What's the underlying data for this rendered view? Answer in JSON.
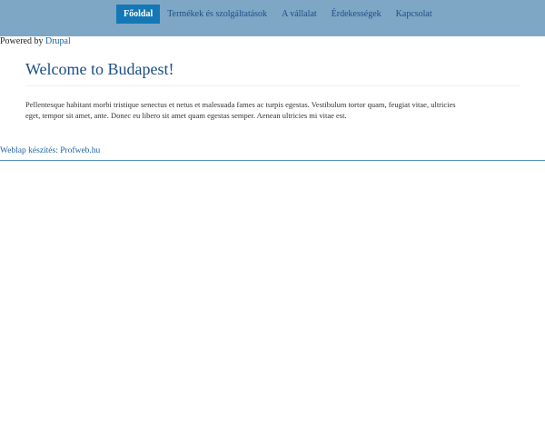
{
  "nav": {
    "items": [
      {
        "label": "Főoldal",
        "active": true
      },
      {
        "label": "Termékek és szolgáltatások",
        "active": false
      },
      {
        "label": "A vállalat",
        "active": false
      },
      {
        "label": "Érdekességek",
        "active": false
      },
      {
        "label": "Kapcsolat",
        "active": false
      }
    ]
  },
  "powered": {
    "prefix": "Powered by",
    "link": "Drupal"
  },
  "content": {
    "title": "Welcome to Budapest!",
    "body": "Pellentesque habitant morbi tristique senectus et netus et malesuada fames ac turpis egestas. Vestibulum tortor quam, feugiat vitae, ultricies eget, tempor sit amet, ante. Donec eu libero sit amet quam egestas semper. Aenean ultricies mi vitae est."
  },
  "footer": {
    "link": "Weblap készítés: Profweb.hu"
  },
  "colors": {
    "topbar": "#7ea6c5",
    "nav_active": "#1478b6",
    "link": "#1f63a5",
    "title": "#1a4d85"
  }
}
